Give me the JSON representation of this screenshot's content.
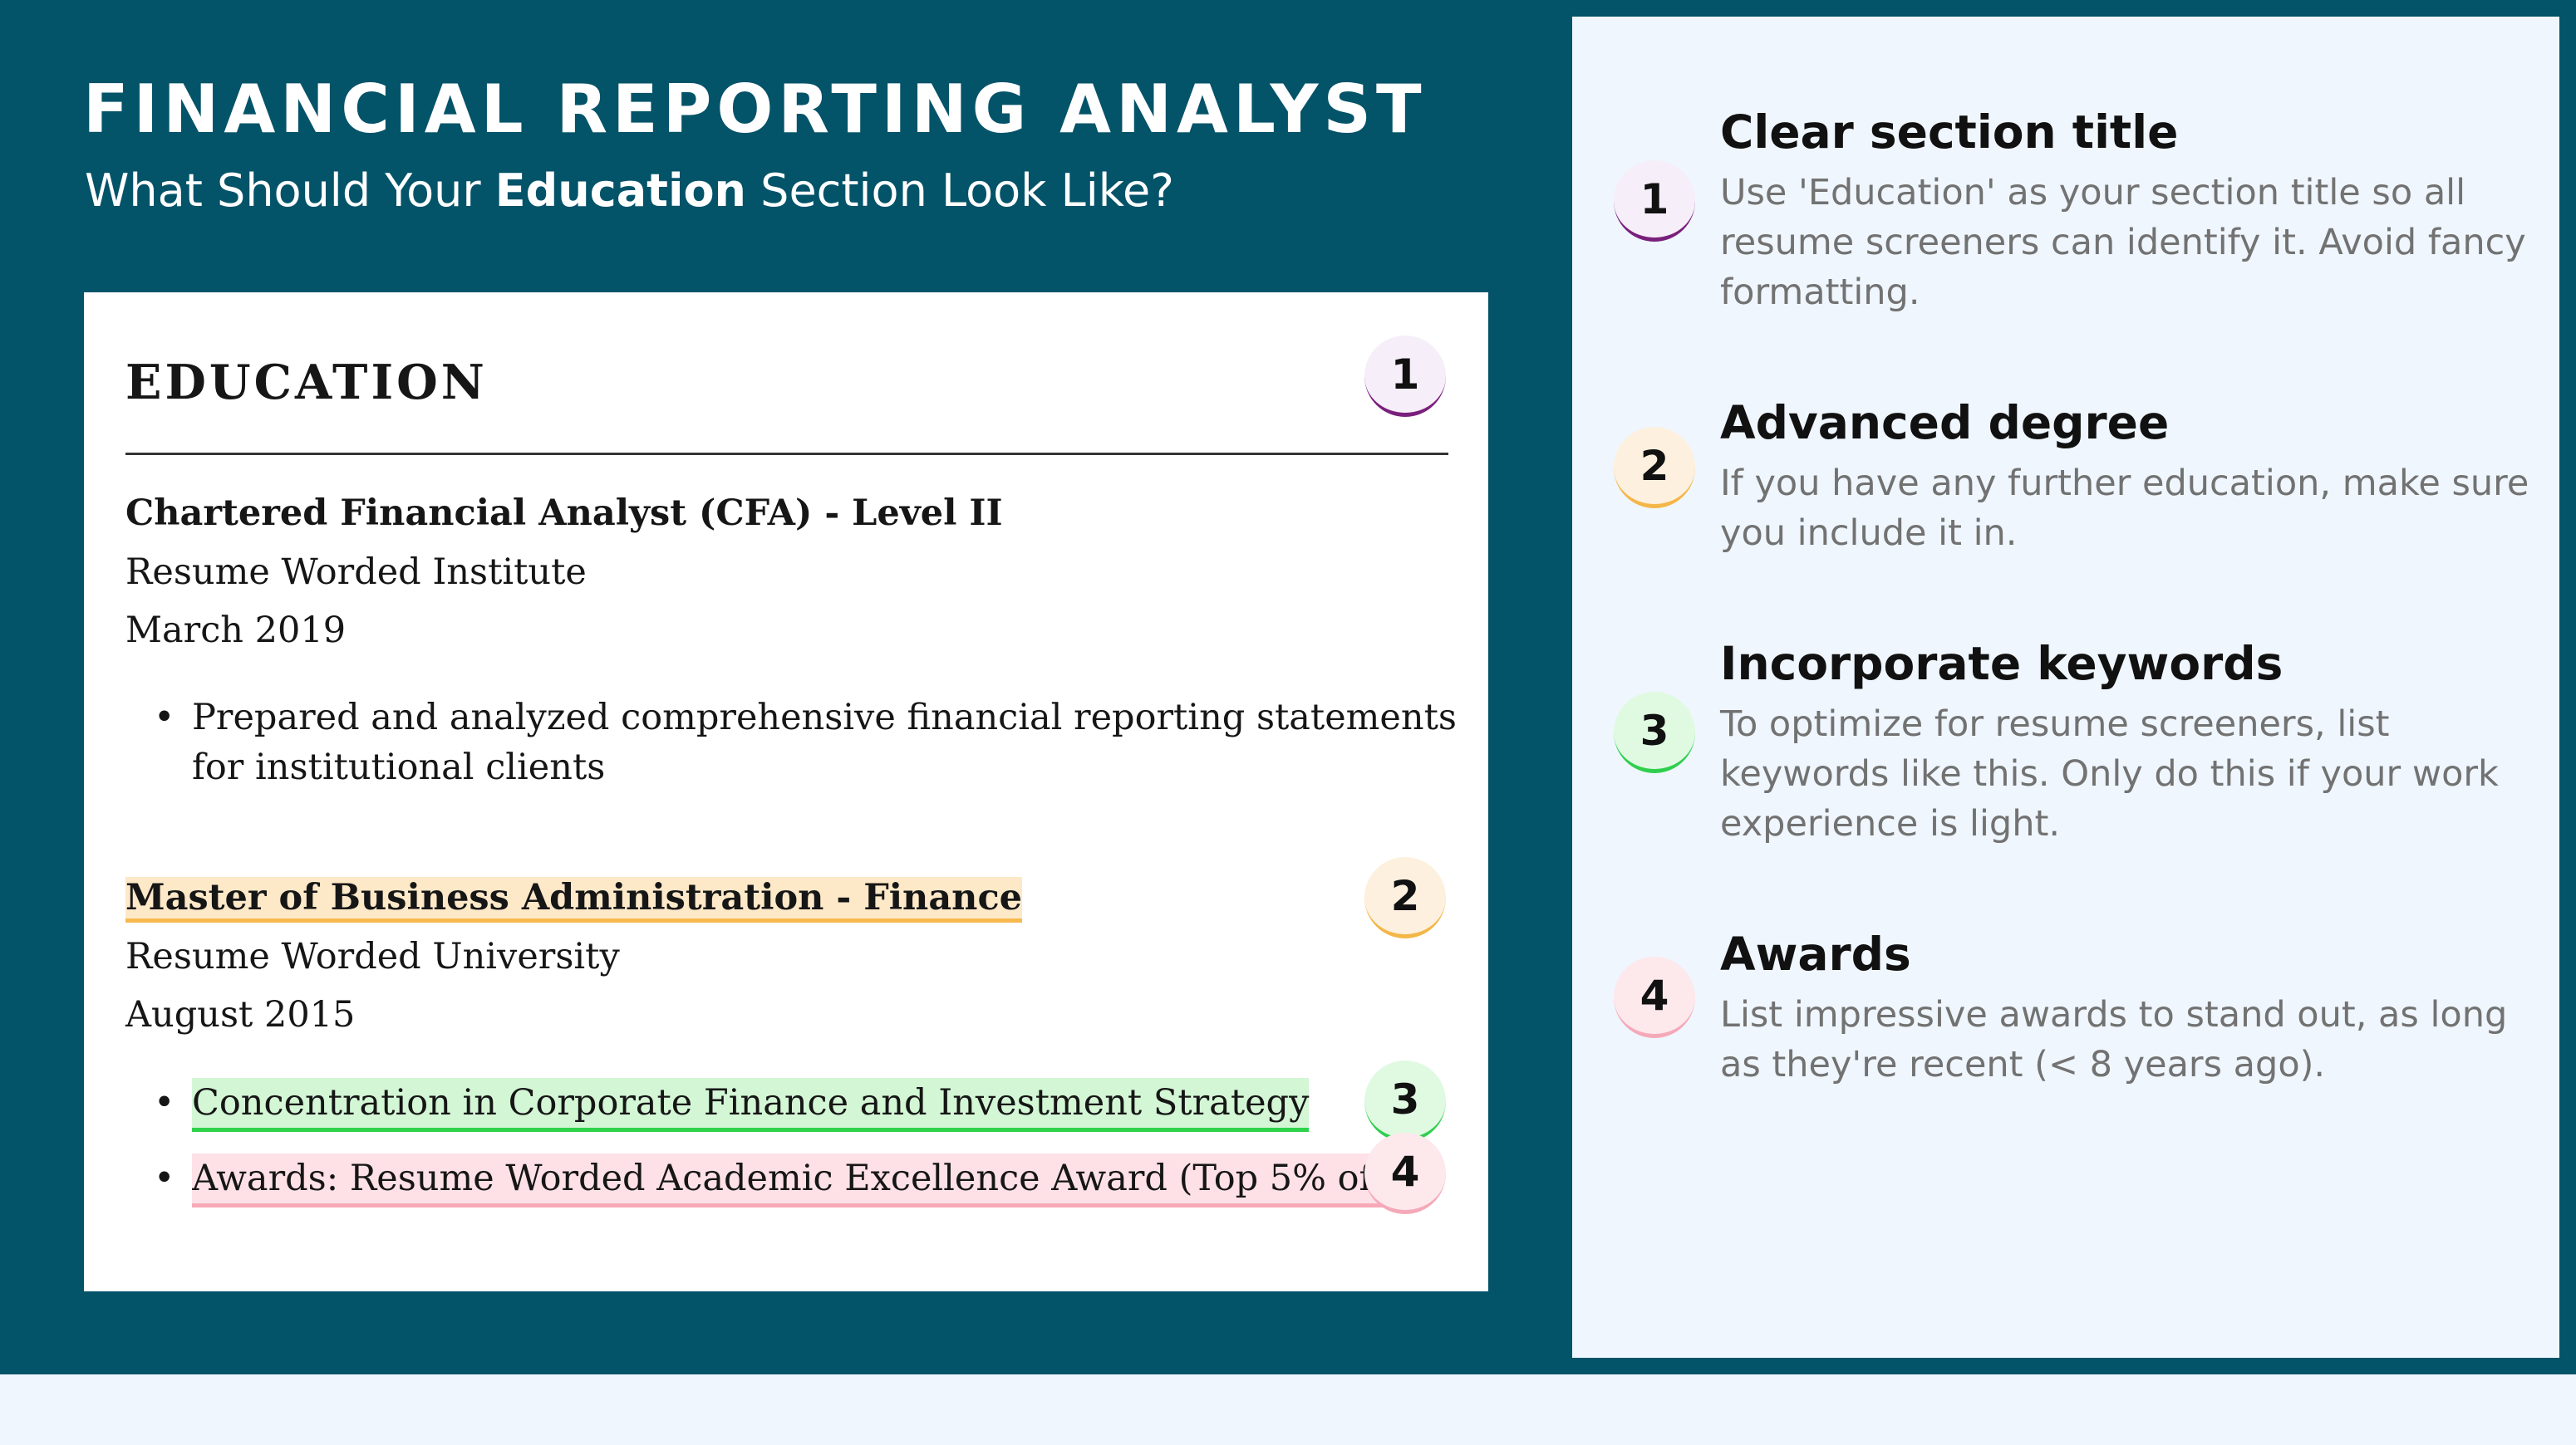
{
  "header": {
    "title": "FINANCIAL REPORTING ANALYST",
    "subtitle_before": "What Should Your ",
    "subtitle_bold": "Education",
    "subtitle_after": " Section Look Like?"
  },
  "resume": {
    "section_title": "EDUCATION",
    "entries": [
      {
        "degree": "Chartered Financial Analyst (CFA) - Level II",
        "school": "Resume Worded Institute",
        "date": "March 2019",
        "bullets": [
          "Prepared and analyzed comprehensive financial reporting statements",
          "for institutional clients"
        ]
      },
      {
        "degree": "Master of Business Administration - Finance",
        "school": "Resume Worded University",
        "date": "August 2015",
        "bullets": [
          "Concentration in Corporate Finance and Investment Strategy",
          "Awards: Resume Worded Academic Excellence Award (Top 5% of class)"
        ]
      }
    ],
    "bullet_char": "•"
  },
  "badges": [
    "1",
    "2",
    "3",
    "4"
  ],
  "tips": [
    {
      "number": "1",
      "title": "Clear section title",
      "body": "Use 'Education' as your section title so all resume screeners can identify it. Avoid fancy formatting."
    },
    {
      "number": "2",
      "title": "Advanced degree",
      "body": "If you have any further education, make sure you include it in."
    },
    {
      "number": "3",
      "title": "Incorporate keywords",
      "body": "To optimize for resume screeners, list keywords like this. Only do this if your work experience is light."
    },
    {
      "number": "4",
      "title": "Awards",
      "body": "List impressive awards to stand out, as long as they're recent (< 8 years ago)."
    }
  ],
  "colors": {
    "banner": "#035369",
    "panel": "#eff6fd",
    "badge1_accent": "#7a1f7c",
    "badge2_accent": "#f4b647",
    "badge3_accent": "#2fcf4d",
    "badge4_accent": "#f5a9b8"
  }
}
